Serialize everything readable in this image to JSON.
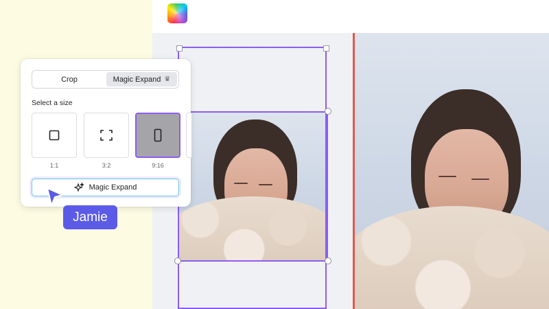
{
  "app": {
    "logo_icon": "canva-color-wheel-icon"
  },
  "panel": {
    "tabs": [
      {
        "label": "Crop",
        "active": false
      },
      {
        "label": "Magic Expand",
        "active": true,
        "icon": "crown-icon"
      }
    ],
    "select_size_label": "Select a size",
    "sizes": [
      {
        "ratio": "1:1",
        "icon": "square-icon",
        "selected": false
      },
      {
        "ratio": "3:2",
        "icon": "expand-corners-icon",
        "selected": false
      },
      {
        "ratio": "9:16",
        "icon": "portrait-rect-icon",
        "selected": true
      }
    ],
    "action_button": {
      "label": "Magic Expand",
      "icon": "sparkle-icon"
    }
  },
  "collaborator": {
    "name": "Jamie",
    "cursor_color": "#5b5be8"
  },
  "colors": {
    "selection": "#8b5cf6",
    "divider": "#e3564c",
    "accent": "#5b5be8"
  }
}
